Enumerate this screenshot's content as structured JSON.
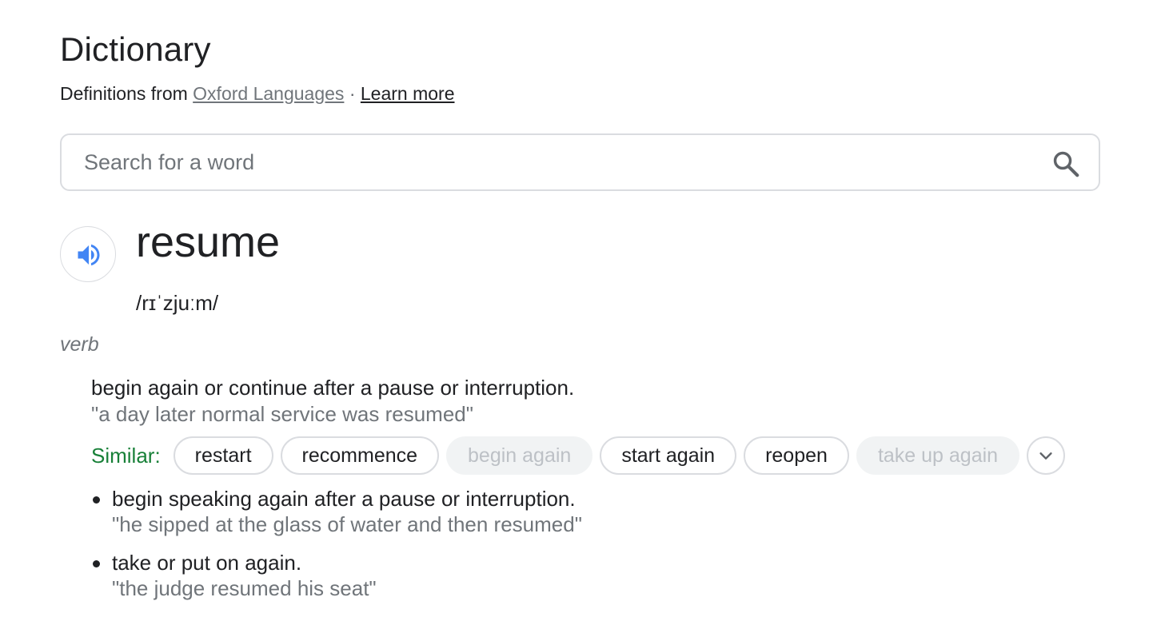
{
  "header": {
    "title": "Dictionary",
    "source_prefix": "Definitions from",
    "source_link": "Oxford Languages",
    "separator": "·",
    "learn_more": "Learn more"
  },
  "search": {
    "placeholder": "Search for a word",
    "value": "",
    "icon": "search-icon"
  },
  "entry": {
    "word": "resume",
    "phonetic": "/rɪˈzjuːm/",
    "audio_icon": "speaker-icon",
    "part_of_speech": "verb",
    "main_definition": "begin again or continue after a pause or interruption.",
    "main_example": "\"a day later normal service was resumed\"",
    "similar_label": "Similar:",
    "similar": [
      {
        "label": "restart",
        "enabled": true
      },
      {
        "label": "recommence",
        "enabled": true
      },
      {
        "label": "begin again",
        "enabled": false
      },
      {
        "label": "start again",
        "enabled": true
      },
      {
        "label": "reopen",
        "enabled": true
      },
      {
        "label": "take up again",
        "enabled": false
      }
    ],
    "expand_icon": "chevron-down-icon",
    "sub_senses": [
      {
        "definition": "begin speaking again after a pause or interruption.",
        "example": "\"he sipped at the glass of water and then resumed\""
      },
      {
        "definition": "take or put on again.",
        "example": "\"the judge resumed his seat\""
      }
    ]
  },
  "colors": {
    "text": "#202124",
    "muted": "#70757a",
    "similar_label": "#188038",
    "speaker_blue": "#4285f4",
    "border": "#dadce0",
    "chip_disabled_bg": "#f1f3f4"
  }
}
